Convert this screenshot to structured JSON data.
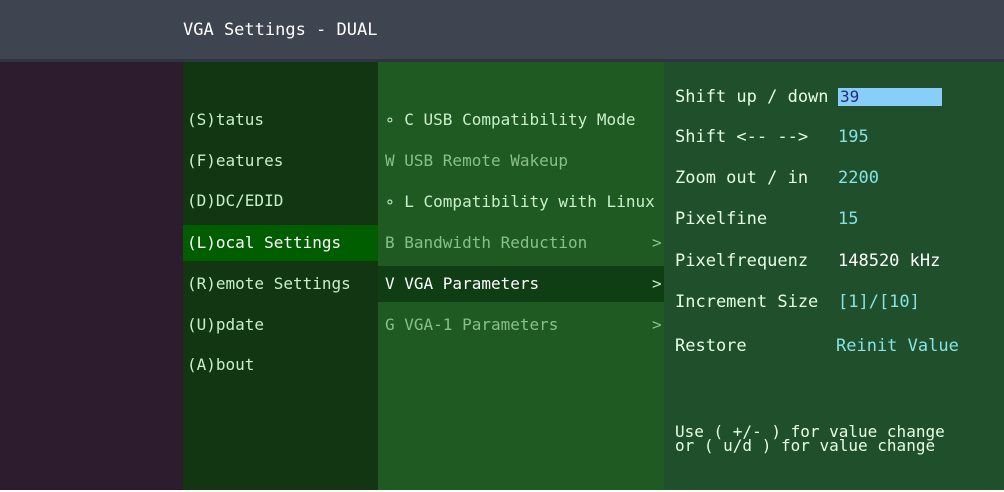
{
  "window": {
    "title": "VGA Settings - DUAL"
  },
  "main_menu": [
    {
      "label": "(S)tatus"
    },
    {
      "label": "(F)eatures"
    },
    {
      "label": "(D)DC/EDID"
    },
    {
      "label": "(L)ocal  Settings"
    },
    {
      "label": "(R)emote Settings"
    },
    {
      "label": "(U)pdate"
    },
    {
      "label": "(A)bout"
    }
  ],
  "submenu": [
    {
      "label": "∘ C USB Compatibility Mode"
    },
    {
      "label": "  W USB Remote Wakeup"
    },
    {
      "label": "∘ L Compatibility with Linux"
    },
    {
      "label": "  B Bandwidth Reduction"
    },
    {
      "label": "  V VGA   Parameters"
    },
    {
      "label": "  G VGA-1 Parameters"
    }
  ],
  "params": {
    "shift_updown": {
      "label": "Shift up / down",
      "value": "39"
    },
    "shift_lr": {
      "label": "Shift <-- -->",
      "value": "195"
    },
    "zoom": {
      "label": "Zoom out / in",
      "value": "2200"
    },
    "pixelfine": {
      "label": "Pixelfine",
      "value": "15"
    },
    "pixelfreq": {
      "label": "Pixelfrequenz",
      "value": "148520 kHz"
    },
    "increment": {
      "label": "Increment Size",
      "value": "[1]/[10]"
    },
    "restore": {
      "label": "Restore",
      "value": "Reinit Value"
    }
  },
  "help": {
    "line1": "Use ( +/- ) for value change",
    "line2": "or  ( u/d ) for value change"
  },
  "colors": {
    "titlebar": "#3e4550",
    "main_menu_bg": "#113611",
    "submenu_bg": "#1e5a22",
    "params_bg": "#1f4f2b",
    "value_text": "#86e2e5",
    "input_highlight": "#87cef9"
  }
}
